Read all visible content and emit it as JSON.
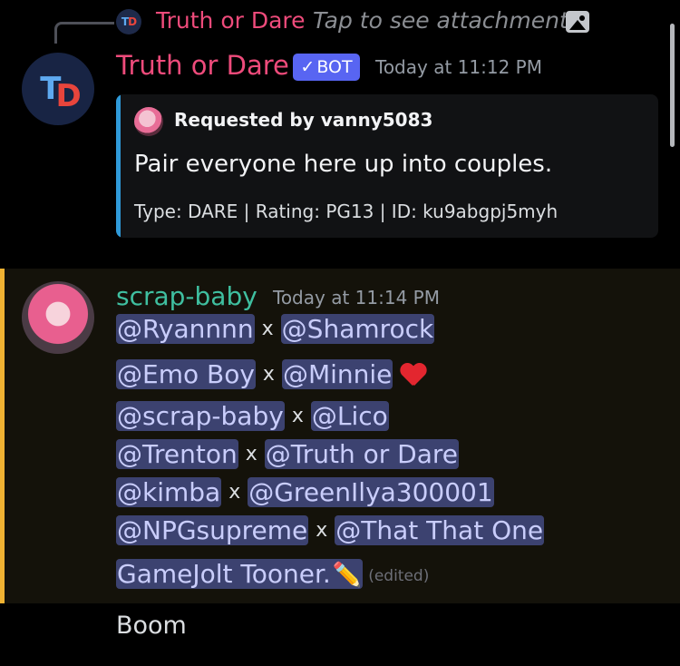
{
  "reply": {
    "avatar_text_t": "T",
    "avatar_text_d": "D",
    "name": "Truth or Dare",
    "attachment_text": "Tap to see attachment",
    "attachment_icon": "image-icon"
  },
  "bot_message": {
    "avatar_text_t": "T",
    "avatar_text_d": "D",
    "author": "Truth or Dare",
    "badge": "BOT",
    "badge_check": "✓",
    "timestamp": "Today at 11:12 PM",
    "embed": {
      "author": "Requested by vanny5083",
      "description": "Pair everyone here up into couples.",
      "footer": "Type: DARE | Rating: PG13 | ID: ku9abgpj5myh",
      "accent_color": "#2f9ad9"
    }
  },
  "user_message": {
    "author": "scrap-baby",
    "timestamp": "Today at 11:14 PM",
    "separator": "x",
    "pairs": [
      {
        "a": "@Ryannnn",
        "b": "@Shamrock"
      },
      {
        "a": "@Emo Boy",
        "b": "@Minnie",
        "emoji": "heart"
      },
      {
        "a": "@scrap-baby",
        "b": "@Lico"
      },
      {
        "a": "@Trenton",
        "b": "@Truth or Dare"
      },
      {
        "a": "@kimba",
        "b": "@GreenIlya300001"
      },
      {
        "a": "@NPGsupreme",
        "b": "@That That One"
      }
    ],
    "last_line": "GameJolt Tooner.",
    "pencil_emoji": "✏️",
    "edited": "(edited)",
    "highlight_color": "#f0b232"
  },
  "next_message": {
    "text": "Boom"
  }
}
